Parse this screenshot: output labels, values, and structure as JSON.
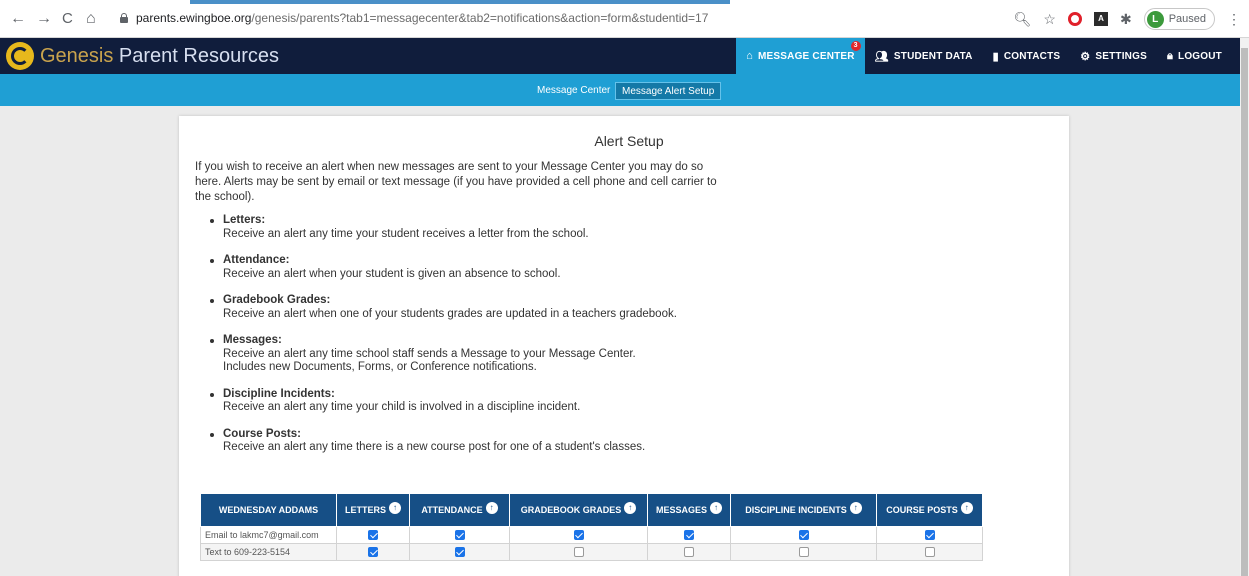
{
  "browser": {
    "back": "←",
    "forward": "→",
    "reload": "C",
    "home": "⌂",
    "url_host": "parents.ewingboe.org",
    "url_path": "/genesis/parents?tab1=messagecenter&tab2=notifications&action=form&studentid=17",
    "profile_initial": "L",
    "profile_label": "Paused",
    "menu": "⋮",
    "pdf_label": "A"
  },
  "app": {
    "logo_first": "Genesis",
    "logo_rest": " Parent Resources",
    "nav": [
      {
        "label": "MESSAGE CENTER",
        "icon": "home-icon",
        "glyph": "⌂",
        "badge": "3"
      },
      {
        "label": "STUDENT DATA",
        "icon": "users-icon",
        "glyph": "👥"
      },
      {
        "label": "CONTACTS",
        "icon": "book-icon",
        "glyph": "▮"
      },
      {
        "label": "SETTINGS",
        "icon": "gear-icon",
        "glyph": "⚙"
      },
      {
        "label": "LOGOUT",
        "icon": "lock-icon",
        "glyph": "🔒"
      }
    ],
    "subnav": [
      {
        "label": "Message Center"
      },
      {
        "label": "Message Alert Setup"
      }
    ]
  },
  "page": {
    "title": "Alert Setup",
    "intro": "If you wish to receive an alert when new messages are sent to your Message Center you may do so here. Alerts may be sent by email or text message (if you have provided a cell phone and cell carrier to the school).",
    "alerts": [
      {
        "name": "Letters:",
        "desc": "Receive an alert any time your student receives a letter from the school."
      },
      {
        "name": "Attendance:",
        "desc": "Receive an alert when your student is given an absence to school."
      },
      {
        "name": "Gradebook Grades:",
        "desc": "Receive an alert when one of your students grades are updated in a teachers gradebook."
      },
      {
        "name": "Messages:",
        "desc": "Receive an alert any time school staff sends a Message to your Message Center.",
        "desc2": "Includes new Documents, Forms, or Conference notifications."
      },
      {
        "name": "Discipline Incidents:",
        "desc": "Receive an alert any time your child is involved in a discipline incident."
      },
      {
        "name": "Course Posts:",
        "desc": "Receive an alert any time there is a new course post for one of a student's classes."
      }
    ]
  },
  "table": {
    "student": "WEDNESDAY ADDAMS",
    "columns": [
      "LETTERS",
      "ATTENDANCE",
      "GRADEBOOK GRADES",
      "MESSAGES",
      "DISCIPLINE INCIDENTS",
      "COURSE POSTS"
    ],
    "header_icon": "↑",
    "rows": [
      {
        "label": "Email to lakmc7@gmail.com",
        "checks": [
          true,
          true,
          true,
          true,
          true,
          true
        ]
      },
      {
        "label": "Text to 609-223-5154",
        "checks": [
          true,
          true,
          false,
          false,
          false,
          false
        ]
      }
    ]
  },
  "colors": {
    "header_bg": "#101d3c",
    "accent_blue": "#1f9fd4",
    "table_header": "#164f86",
    "badge_red": "#e2282c",
    "logo_gold": "#e7b81c"
  }
}
